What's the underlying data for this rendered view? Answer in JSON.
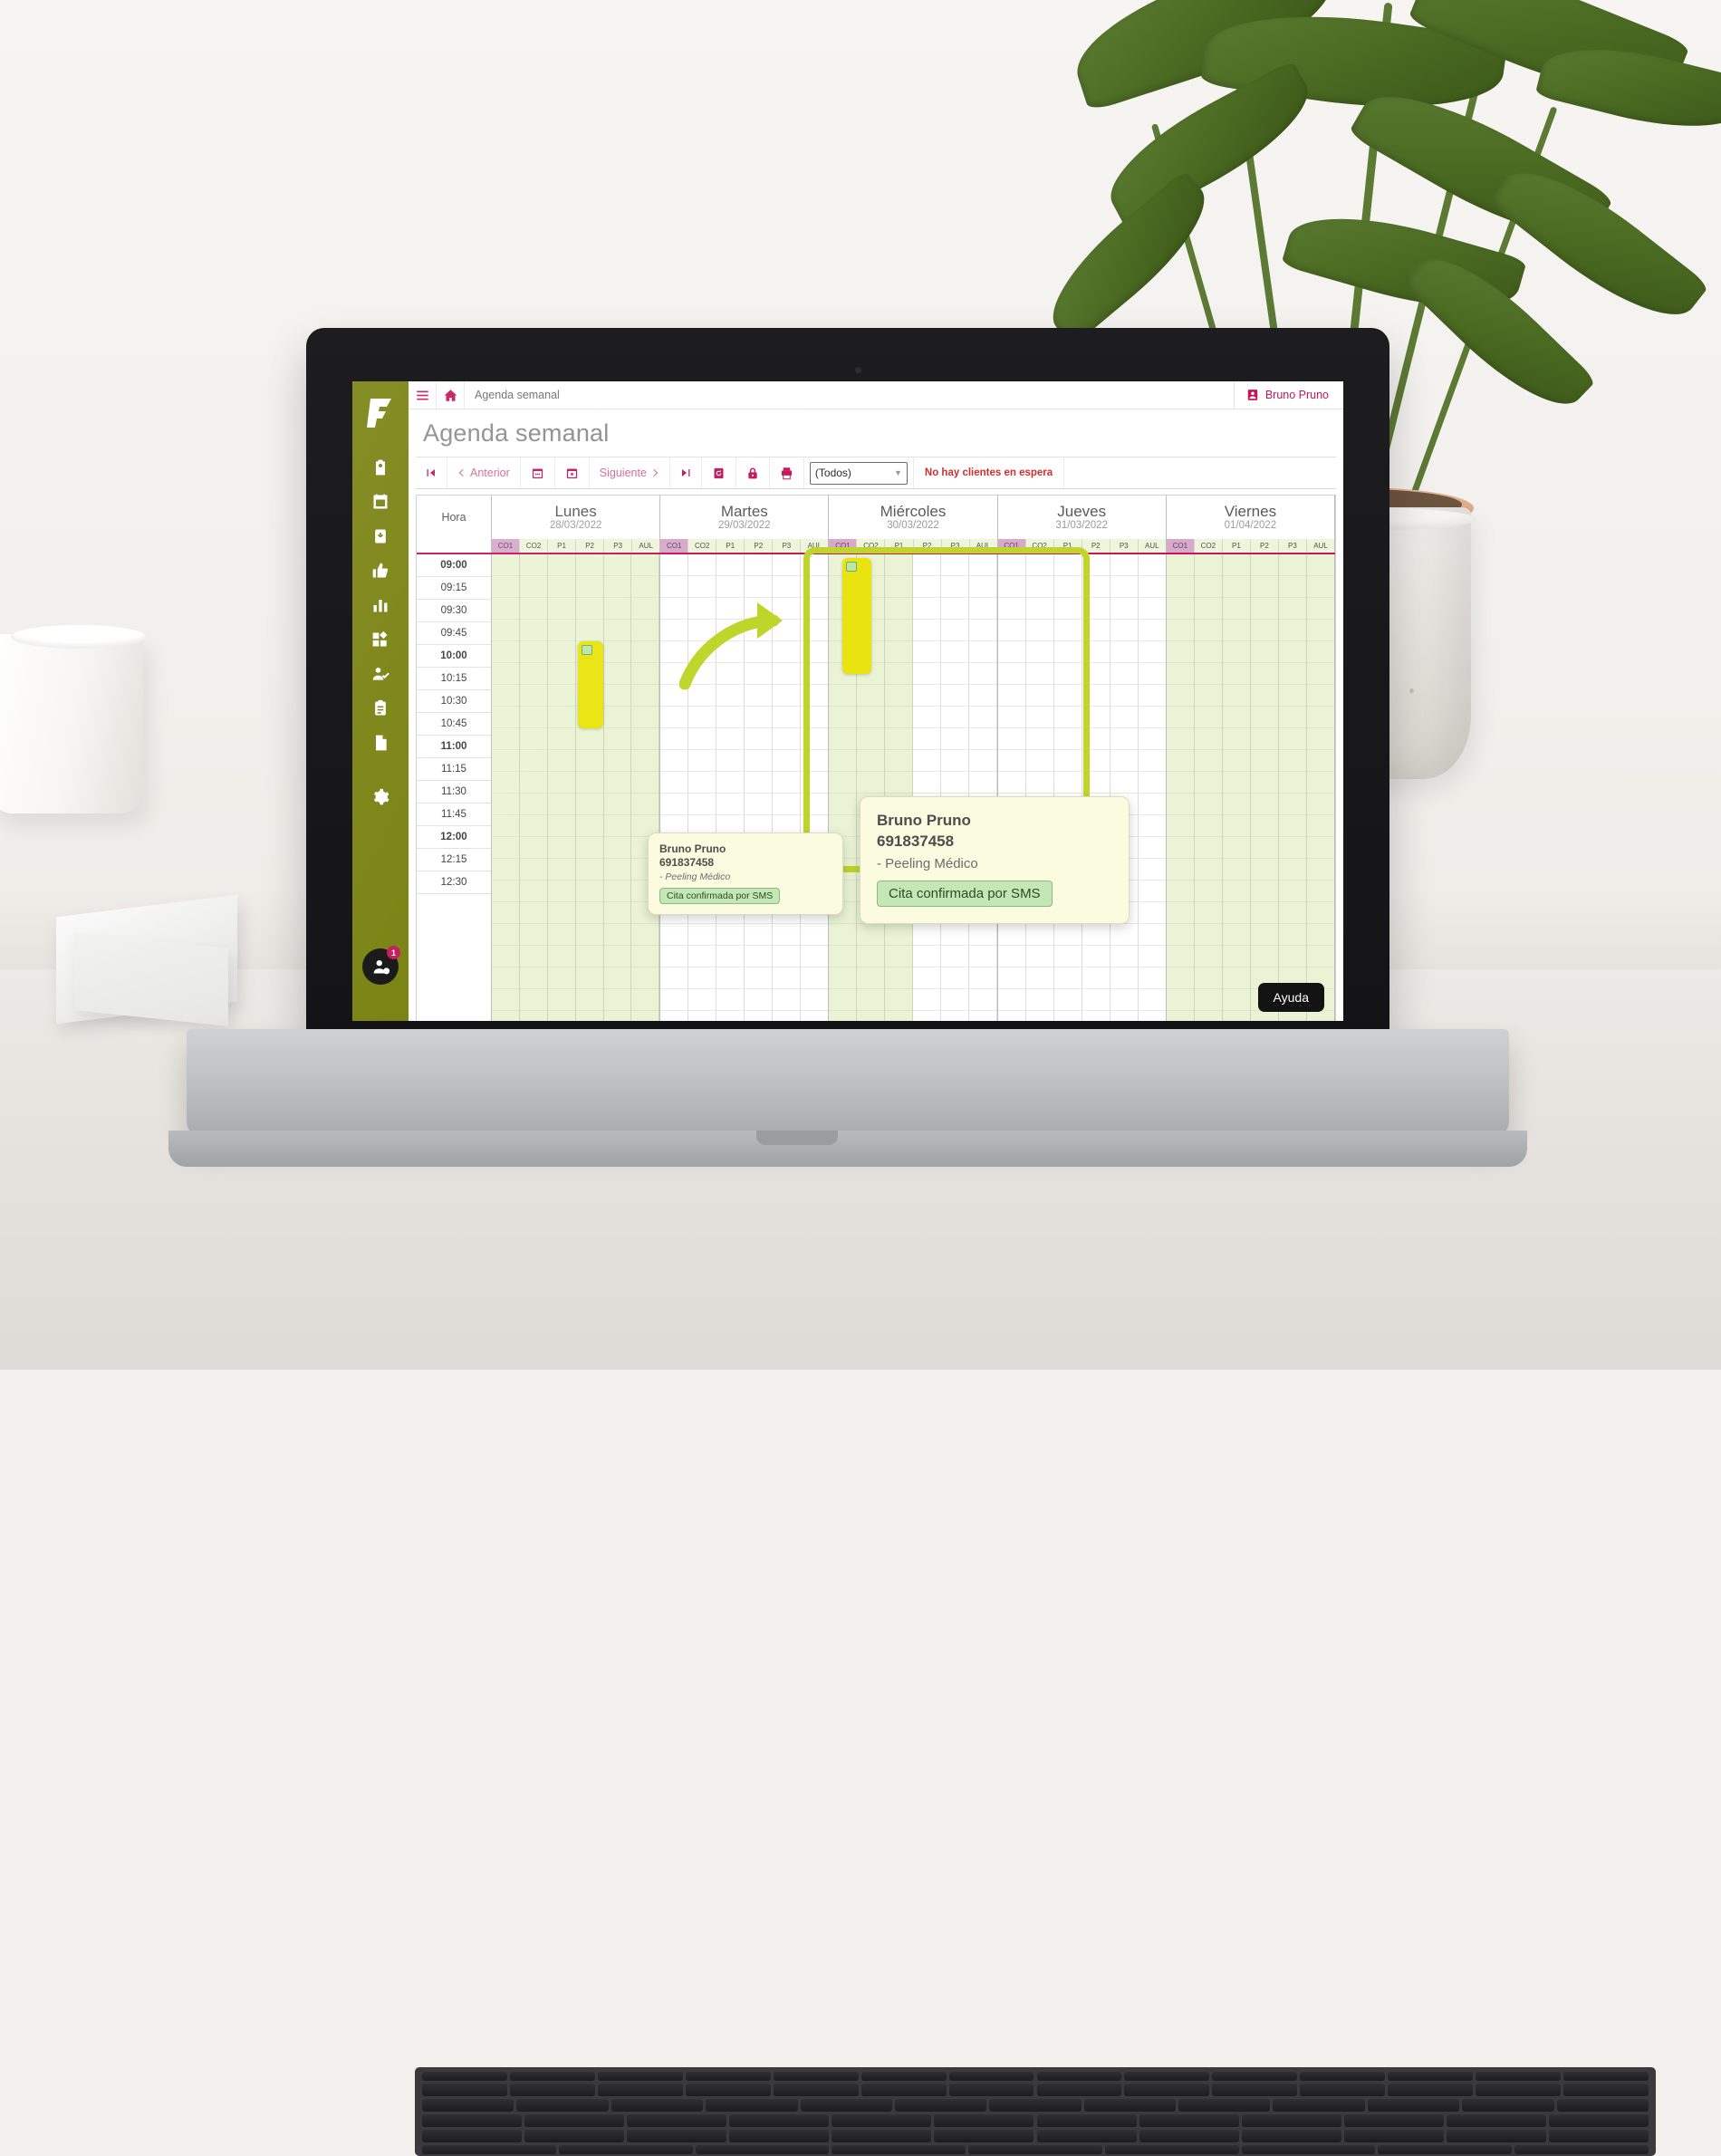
{
  "app": {
    "brand_color": "#77800d",
    "accent_color": "#c2185b",
    "logo_letter": "F"
  },
  "topbar": {
    "menu_icon": "hamburger-icon",
    "home_icon": "home-icon",
    "breadcrumb": "Agenda semanal",
    "user_icon": "user-badge-icon",
    "user_name": "Bruno Pruno"
  },
  "page": {
    "title": "Agenda semanal"
  },
  "sidebar": {
    "items": [
      {
        "name": "clipboard-person-icon",
        "label": "Fichas"
      },
      {
        "name": "calendar-icon",
        "label": "Agenda"
      },
      {
        "name": "inbox-download-icon",
        "label": "Entradas"
      },
      {
        "name": "thumbs-up-icon",
        "label": "Valoraciones"
      },
      {
        "name": "bar-chart-icon",
        "label": "Estadisticas"
      },
      {
        "name": "apps-grid-icon",
        "label": "Modulos"
      },
      {
        "name": "user-check-icon",
        "label": "Clientes"
      },
      {
        "name": "clipboard-list-icon",
        "label": "Tareas"
      },
      {
        "name": "document-icon",
        "label": "Documentos"
      },
      {
        "name": "gear-icon",
        "label": "Configuracion"
      }
    ],
    "avatar_icon": "user-circle-icon",
    "avatar_badge": "1"
  },
  "toolbar": {
    "first_label": "|‹",
    "prev_label": "Anterior",
    "calendar_week_icon": "calendar-week-icon",
    "calendar_day_icon": "calendar-day-icon",
    "next_label": "Siguiente",
    "last_label": "›|",
    "refresh_icon": "refresh-icon",
    "lock_icon": "lock-icon",
    "print_icon": "print-icon",
    "filter_value": "(Todos)",
    "filter_caret": "chevron-down-icon",
    "waiting_text": "No hay clientes en espera"
  },
  "grid": {
    "hour_header": "Hora",
    "days": [
      {
        "name": "Lunes",
        "date": "28/03/2022"
      },
      {
        "name": "Martes",
        "date": "29/03/2022"
      },
      {
        "name": "Miércoles",
        "date": "30/03/2022"
      },
      {
        "name": "Jueves",
        "date": "31/03/2022"
      },
      {
        "name": "Viernes",
        "date": "01/04/2022"
      }
    ],
    "resources": [
      "CO1",
      "CO2",
      "P1",
      "P2",
      "P3",
      "AUL"
    ],
    "times": [
      {
        "t": "09:00",
        "major": true
      },
      {
        "t": "09:15",
        "major": false
      },
      {
        "t": "09:30",
        "major": false
      },
      {
        "t": "09:45",
        "major": false
      },
      {
        "t": "10:00",
        "major": true
      },
      {
        "t": "10:15",
        "major": false
      },
      {
        "t": "10:30",
        "major": false
      },
      {
        "t": "10:45",
        "major": false
      },
      {
        "t": "11:00",
        "major": true
      },
      {
        "t": "11:15",
        "major": false
      },
      {
        "t": "11:30",
        "major": false
      },
      {
        "t": "11:45",
        "major": false
      },
      {
        "t": "12:00",
        "major": true
      },
      {
        "t": "12:15",
        "major": false
      },
      {
        "t": "12:30",
        "major": false
      }
    ]
  },
  "appointments": [
    {
      "id": "appt-lunes-p1",
      "client": "Bruno Pruno",
      "phone": "691837458",
      "service": "- Peeling Médico",
      "status": "Cita confirmada por SMS"
    },
    {
      "id": "appt-miercoles-co2",
      "client": "Bruno Pruno",
      "phone": "691837458",
      "service": "- Peeling Médico",
      "status": "Cita confirmada por SMS"
    }
  ],
  "tooltip_small": {
    "client": "Bruno Pruno",
    "phone": "691837458",
    "service": "- Peeling Médico",
    "status": "Cita confirmada por SMS"
  },
  "tooltip_big": {
    "client": "Bruno Pruno",
    "phone": "691837458",
    "service": "- Peeling Médico",
    "status": "Cita confirmada por SMS"
  },
  "help": {
    "label": "Ayuda"
  }
}
